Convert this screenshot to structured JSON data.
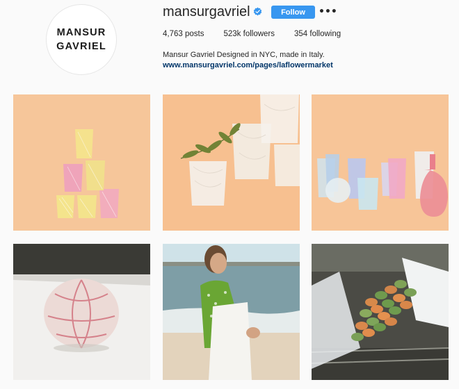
{
  "profile": {
    "avatar_lines": [
      "MANSUR",
      "GAVRIEL"
    ],
    "username": "mansurgavriel",
    "verified": true,
    "follow_label": "Follow",
    "more_label": "•••",
    "stats": {
      "posts_count": "4,763",
      "posts_label": "posts",
      "followers_count": "523k",
      "followers_label": "followers",
      "following_count": "354",
      "following_label": "following"
    },
    "bio_name": "Mansur Gavriel",
    "bio_text": " Designed in NYC, made in Italy.",
    "bio_link": "www.mansurgavriel.com/pages/laflowermarket"
  },
  "colors": {
    "accent": "#3897f0",
    "link": "#003569",
    "peach_bg": "#f7c596"
  },
  "icons": {
    "verified": "verified-badge-icon",
    "more": "ellipsis-icon"
  }
}
